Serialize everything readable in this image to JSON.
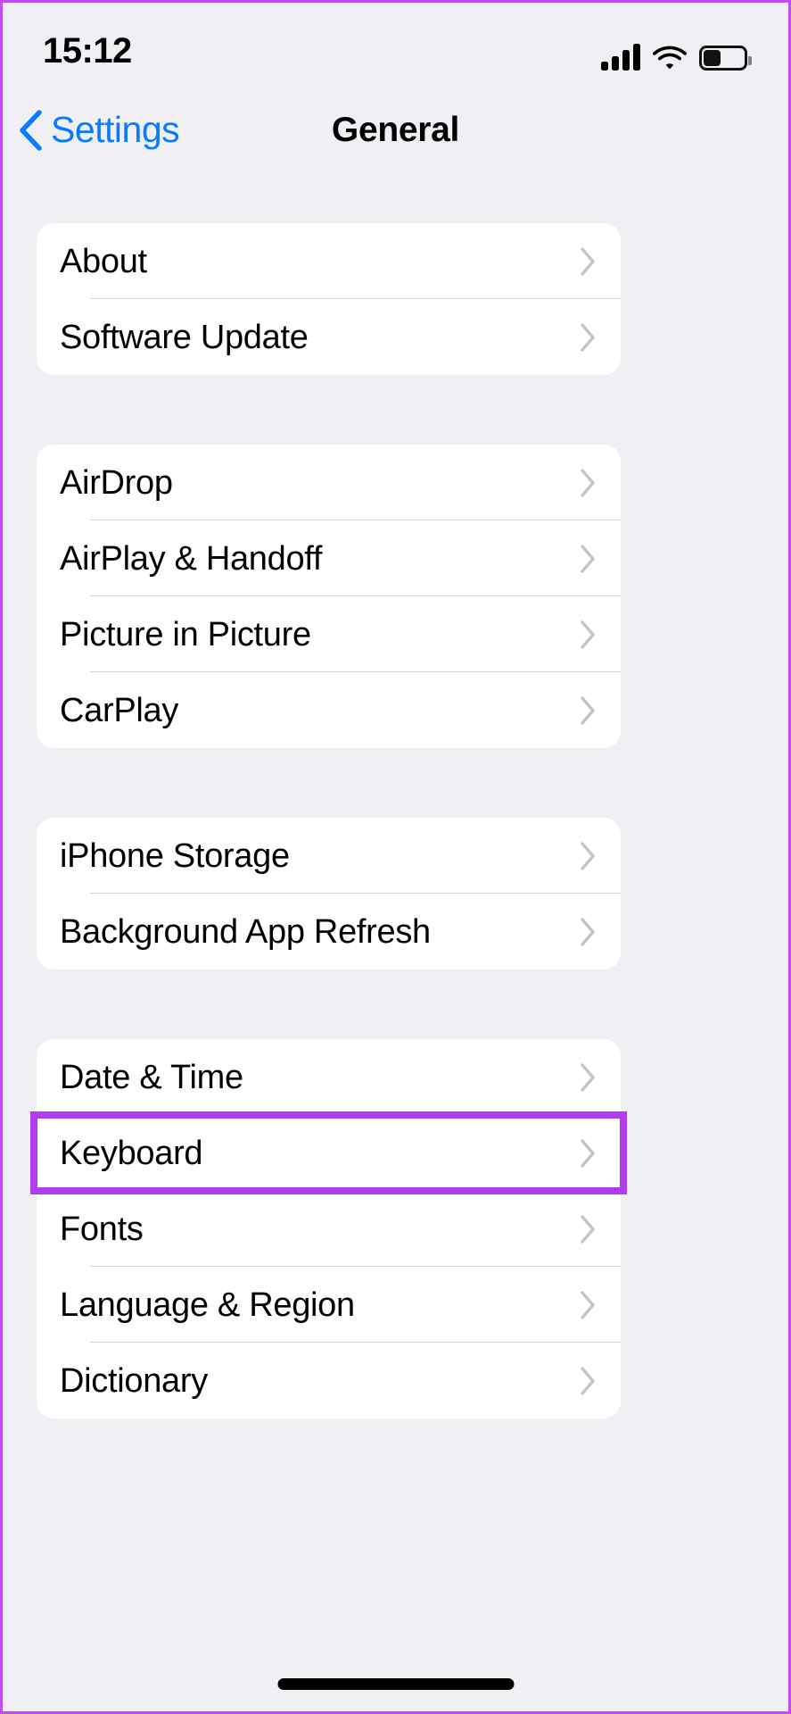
{
  "status_bar": {
    "time": "15:12",
    "signal_icon": "cellular-signal-icon",
    "signal_bars_total": 4,
    "signal_bars_filled": 4,
    "wifi_icon": "wifi-icon",
    "wifi_strength": "full",
    "battery_icon": "battery-icon",
    "battery_percent": 40
  },
  "nav_bar": {
    "back_label": "Settings",
    "back_icon": "chevron-left-icon",
    "title": "General"
  },
  "colors": {
    "background": "#F0EFF4",
    "card": "#FFFFFF",
    "accent_blue": "#0A7CFF",
    "separator": "#D3D2D6",
    "chevron": "#C4C4C8",
    "highlight_purple": "#B23CF0",
    "text": "#000000"
  },
  "groups": [
    {
      "rows": [
        {
          "label": "About",
          "accessory": "chevron-right-icon"
        },
        {
          "label": "Software Update",
          "accessory": "chevron-right-icon"
        }
      ]
    },
    {
      "rows": [
        {
          "label": "AirDrop",
          "accessory": "chevron-right-icon"
        },
        {
          "label": "AirPlay & Handoff",
          "accessory": "chevron-right-icon"
        },
        {
          "label": "Picture in Picture",
          "accessory": "chevron-right-icon"
        },
        {
          "label": "CarPlay",
          "accessory": "chevron-right-icon"
        }
      ]
    },
    {
      "rows": [
        {
          "label": "iPhone Storage",
          "accessory": "chevron-right-icon"
        },
        {
          "label": "Background App Refresh",
          "accessory": "chevron-right-icon"
        }
      ]
    },
    {
      "rows": [
        {
          "label": "Date & Time",
          "accessory": "chevron-right-icon"
        },
        {
          "label": "Keyboard",
          "accessory": "chevron-right-icon",
          "highlighted": true
        },
        {
          "label": "Fonts",
          "accessory": "chevron-right-icon"
        },
        {
          "label": "Language & Region",
          "accessory": "chevron-right-icon"
        },
        {
          "label": "Dictionary",
          "accessory": "chevron-right-icon"
        }
      ]
    }
  ],
  "home_indicator": "home-indicator-bar"
}
